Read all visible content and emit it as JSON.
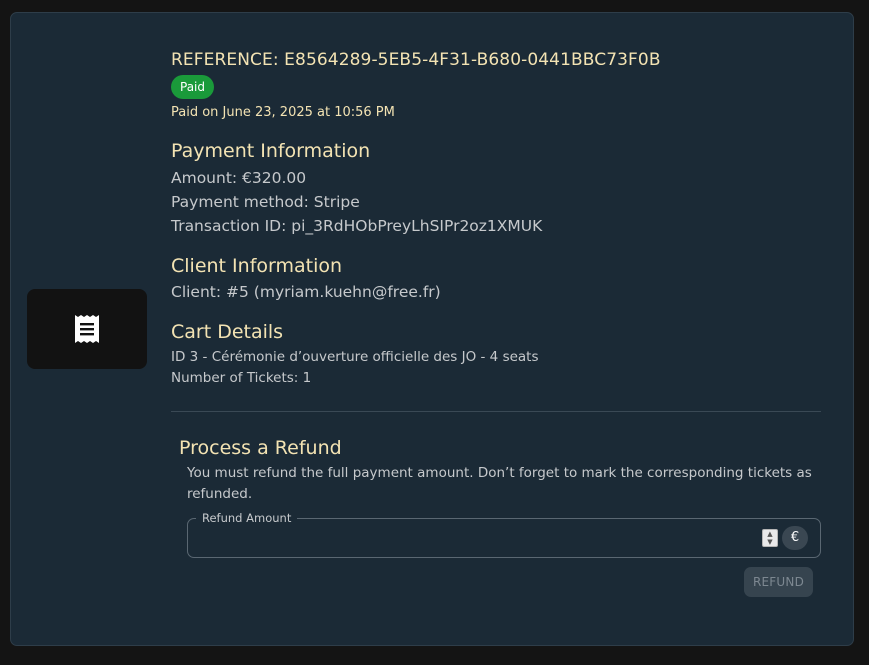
{
  "order": {
    "reference": "REFERENCE: E8564289-5EB5-4F31-B680-0441BBC73F0B",
    "status_badge": "Paid",
    "paid_on": "Paid on June 23, 2025 at 10:56 PM"
  },
  "payment": {
    "heading": "Payment Information",
    "amount": "Amount: €320.00",
    "method": "Payment method: Stripe",
    "transaction_id": "Transaction ID: pi_3RdHObPreyLhSIPr2oz1XMUK"
  },
  "client": {
    "heading": "Client Information",
    "client": "Client: #5 (myriam.kuehn@free.fr)"
  },
  "cart": {
    "heading": "Cart Details",
    "item": "ID 3 - Cérémonie d’ouverture officielle des JO - 4 seats",
    "ticket_count": "Number of Tickets: 1"
  },
  "refund": {
    "heading": "Process a Refund",
    "description": "You must refund the full payment amount. Don’t forget to mark the corresponding tickets as refunded.",
    "field_label": "Refund Amount",
    "field_value": "",
    "currency_symbol": "€",
    "button_label": "REFUND"
  },
  "icons": {
    "thumbnail": "receipt-icon",
    "spinner": "number-spinner-icon"
  },
  "colors": {
    "card_background": "#1b2a36",
    "heading": "#f3e3b3",
    "badge_paid": "#1a9a3a",
    "body_text": "#c6c9cc",
    "button_disabled": "#36444f"
  }
}
